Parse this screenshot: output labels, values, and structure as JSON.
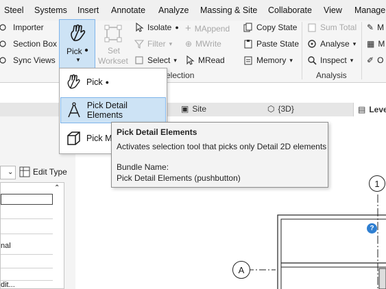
{
  "menubar": {
    "items": [
      "Steel",
      "Systems",
      "Insert",
      "Annotate",
      "Analyze",
      "Massing & Site",
      "Collaborate",
      "View",
      "Manage"
    ]
  },
  "ribbon": {
    "col1": [
      "Importer",
      "Section Box",
      "Sync Views"
    ],
    "pick_label": "Pick",
    "set_workset_line1": "Set",
    "set_workset_line2": "Workset",
    "isolate": "Isolate",
    "filter": "Filter",
    "select": "Select",
    "mappend": "MAppend",
    "mwrite": "MWrite",
    "mread": "MRead",
    "copy_state": "Copy State",
    "paste_state": "Paste State",
    "memory": "Memory",
    "sum_total": "Sum Total",
    "analyse": "Analyse",
    "inspect": "Inspect",
    "m1": "M",
    "m2": "M",
    "o": "O",
    "selection_group": "election",
    "analysis_group": "Analysis"
  },
  "dropdown": {
    "items": [
      "Pick",
      "Pick Detail Elements",
      "Pick M"
    ]
  },
  "tooltip": {
    "title": "Pick Detail Elements",
    "description": "Activates selection tool that picks only Detail 2D elements",
    "bundle_label": "Bundle Name:",
    "bundle_value": "Pick Detail Elements (pushbutton)"
  },
  "tabs": {
    "site": "Site",
    "three_d": "{3D}",
    "level": "Leve"
  },
  "props": {
    "edit_type": "Edit Type",
    "rows": [
      "",
      "",
      "",
      "nal",
      "",
      "",
      "dit..."
    ]
  },
  "canvas": {
    "grid_1": "1",
    "grid_a": "A",
    "marker": "?"
  },
  "colors": {
    "highlight": "#cde3f5",
    "highlight_border": "#7eb4ea",
    "tooltip_bg": "#f3f3f3",
    "marker_blue": "#2f7fd1"
  }
}
